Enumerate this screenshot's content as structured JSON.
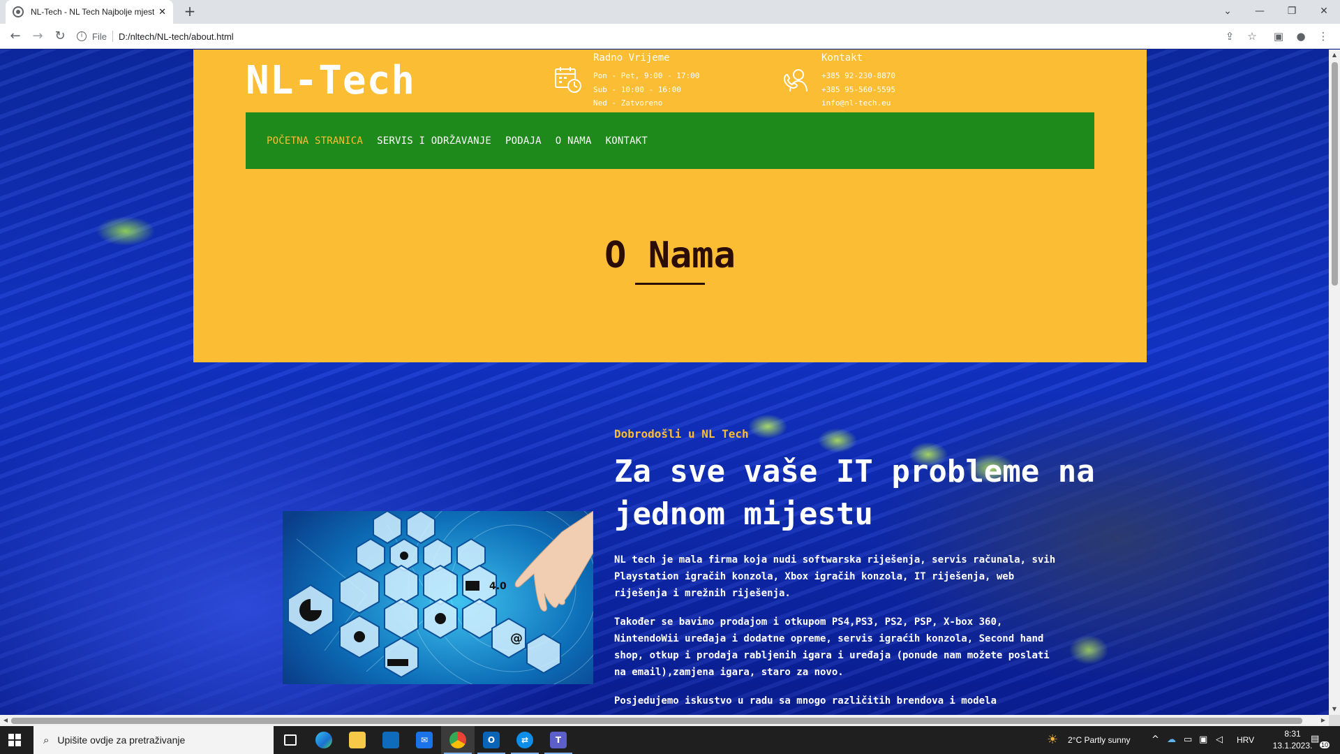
{
  "browser": {
    "tab_title": "NL-Tech - NL Tech Najbolje mjesto",
    "tab_close": "✕",
    "new_tab": "+",
    "scheme": "File",
    "url": "D:/nltech/NL-tech/about.html"
  },
  "site": {
    "logo": "NL-Tech",
    "hours": {
      "heading": "Radno Vrijeme",
      "lines": [
        "Pon - Pet, 9:00 - 17:00",
        "Sub - 10:00 - 16:00",
        "Ned - Zatvoreno"
      ]
    },
    "contact": {
      "heading": "Kontakt",
      "lines": [
        "+385 92-230-8870",
        "+385 95-560-5595",
        "info@nl-tech.eu"
      ]
    },
    "nav": [
      {
        "label": "POČETNA STRANICA",
        "active": true
      },
      {
        "label": "SERVIS I ODRŽAVANJE",
        "active": false
      },
      {
        "label": "PODAJA",
        "active": false
      },
      {
        "label": "O NAMA",
        "active": false
      },
      {
        "label": "KONTAKT",
        "active": false
      }
    ],
    "page_title": "O Nama",
    "welcome": "Dobrodošli u NL Tech",
    "headline": "Za sve vaše IT probleme na jednom mijestu",
    "paragraphs": [
      "NL tech je mala firma koja nudi softwarska riješenja, servis računala, svih Playstation igračih konzola, Xbox igračih konzola, IT riješenja, web riješenja i mrežnih riješenja.",
      "Također se bavimo prodajom i otkupom PS4,PS3, PS2, PSP, X-box 360, NintendoWii uređaja i dodatne opreme, servis igraćih konzola, Second hand shop, otkup i prodaja rabljenih igara i uređaja (ponude nam možete poslati na email),zamjena igara, staro za novo.",
      "Posjedujemo iskustvo u radu sa mnogo različitih brendova i modela"
    ],
    "image_badge": "4.0"
  },
  "colors": {
    "header_bg": "#fbbd33",
    "nav_bg": "#1f8a1c",
    "accent": "#fbbd33",
    "title_color": "#2b0d05"
  },
  "taskbar": {
    "search_placeholder": "Upišite ovdje za pretraživanje",
    "weather": "2°C  Partly sunny",
    "language": "HRV",
    "time": "8:31",
    "date": "13.1.2023.",
    "notifications": "10"
  }
}
